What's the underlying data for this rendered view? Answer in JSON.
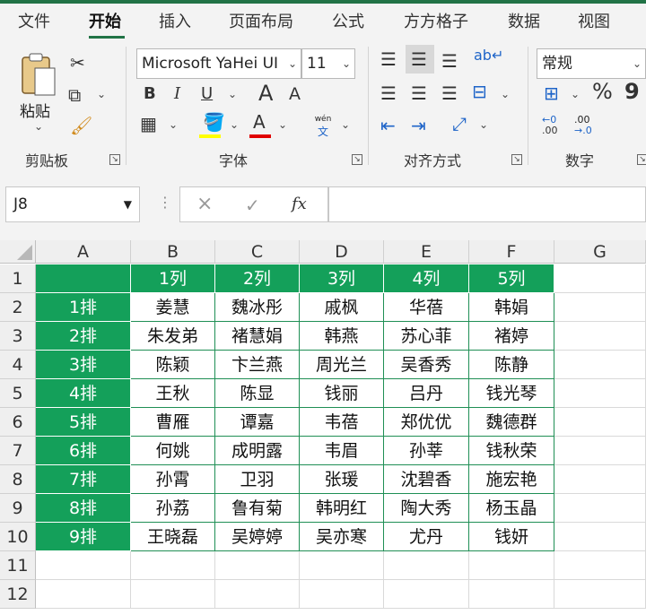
{
  "menu_tabs": [
    "文件",
    "开始",
    "插入",
    "页面布局",
    "公式",
    "方方格子",
    "数据",
    "视图"
  ],
  "ribbon": {
    "clipboard": {
      "paste_label": "粘贴",
      "group_label": "剪贴板"
    },
    "font": {
      "font_name": "Microsoft YaHei UI",
      "font_size": "11",
      "bold": "B",
      "italic": "I",
      "underline": "U",
      "grow": "A",
      "shrink": "A",
      "font_color": "A",
      "pinyin_top": "wén",
      "pinyin_bottom": "文",
      "group_label": "字体"
    },
    "alignment": {
      "group_label": "对齐方式"
    },
    "number": {
      "format": "常规",
      "percent": "%",
      "comma": "9",
      "inc_decimal_top": "←0",
      "inc_decimal_bottom": ".00",
      "dec_decimal_top": ".00",
      "dec_decimal_bottom": "→.0",
      "group_label": "数字"
    }
  },
  "formula_bar": {
    "name_box": "J8",
    "cancel": "×",
    "enter": "✓",
    "fx": "fx",
    "formula": ""
  },
  "columns": [
    "A",
    "B",
    "C",
    "D",
    "E",
    "F",
    "G"
  ],
  "rows": [
    "1",
    "2",
    "3",
    "4",
    "5",
    "6",
    "7",
    "8",
    "9",
    "10",
    "11",
    "12"
  ],
  "header_row": [
    "",
    "1列",
    "2列",
    "3列",
    "4列",
    "5列"
  ],
  "row_labels": [
    "1排",
    "2排",
    "3排",
    "4排",
    "5排",
    "6排",
    "7排",
    "8排",
    "9排"
  ],
  "names": [
    [
      "姜慧",
      "魏冰彤",
      "戚枫",
      "华蓓",
      "韩娟"
    ],
    [
      "朱发弟",
      "褚慧娟",
      "韩燕",
      "苏心菲",
      "褚婷"
    ],
    [
      "陈颖",
      "卞兰燕",
      "周光兰",
      "吴香秀",
      "陈静"
    ],
    [
      "王秋",
      "陈显",
      "钱丽",
      "吕丹",
      "钱光琴"
    ],
    [
      "曹雁",
      "谭嘉",
      "韦蓓",
      "郑优优",
      "魏德群"
    ],
    [
      "何姚",
      "成明露",
      "韦眉",
      "孙莘",
      "钱秋荣"
    ],
    [
      "孙霄",
      "卫羽",
      "张瑗",
      "沈碧香",
      "施宏艳"
    ],
    [
      "孙荔",
      "鲁有菊",
      "韩明红",
      "陶大秀",
      "杨玉晶"
    ],
    [
      "王晓磊",
      "吴婷婷",
      "吴亦寒",
      "尤丹",
      "钱妍"
    ]
  ],
  "colors": {
    "accent": "#217346",
    "header_fill": "#14a05a"
  }
}
